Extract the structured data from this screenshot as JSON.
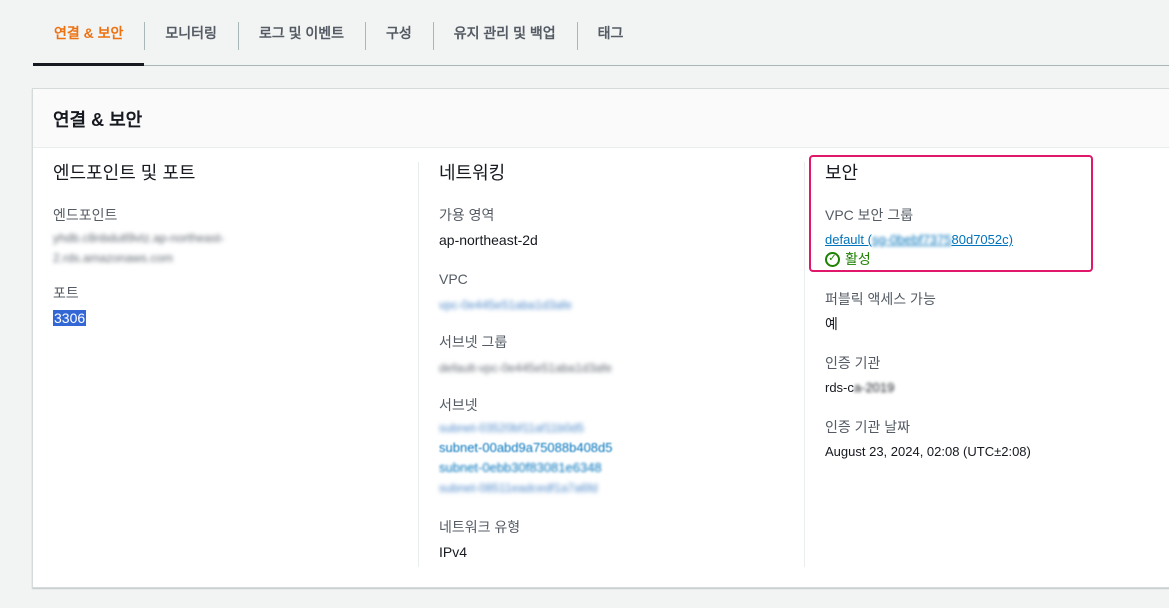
{
  "tabs": [
    {
      "label": "연결 & 보안",
      "active": true
    },
    {
      "label": "모니터링",
      "active": false
    },
    {
      "label": "로그 및 이벤트",
      "active": false
    },
    {
      "label": "구성",
      "active": false
    },
    {
      "label": "유지 관리 및 백업",
      "active": false
    },
    {
      "label": "태그",
      "active": false
    }
  ],
  "panel": {
    "title": "연결 & 보안",
    "endpoint_section": {
      "title": "엔드포인트 및 포트",
      "endpoint_label": "엔드포인트",
      "endpoint_value_line1": "yhdb.c8nbdutl9vtz.ap-northeast-",
      "endpoint_value_line2": "2.rds.amazonaws.com",
      "port_label": "포트",
      "port_value": "3306"
    },
    "network_section": {
      "title": "네트워킹",
      "az_label": "가용 영역",
      "az_value": "ap-northeast-2d",
      "vpc_label": "VPC",
      "vpc_value": "vpc-0e445e51aba1d3afe",
      "subnet_group_label": "서브넷 그룹",
      "subnet_group_value": "default-vpc-0e445e51aba1d3afe",
      "subnets_label": "서브넷",
      "subnets": [
        "subnet-03520bf11af11b0d5",
        "subnet-00abd9a75088b408d5",
        "subnet-0ebb30f83081e6348",
        "subnet-08511eadcedf1a7a6fd"
      ],
      "network_type_label": "네트워크 유형",
      "network_type_value": "IPv4"
    },
    "security_section": {
      "title": "보안",
      "sg_label": "VPC 보안 그룹",
      "sg_value_prefix": "default (",
      "sg_value_blurred": "sg-0bebf7375",
      "sg_value_suffix": "80d7052c)",
      "sg_status": "활성",
      "public_access_label": "퍼블릭 액세스 가능",
      "public_access_value": "예",
      "ca_label": "인증 기관",
      "ca_value_prefix": "rds-c",
      "ca_value_blurred": "a-2019",
      "ca_date_label": "인증 기관 날짜",
      "ca_date_value": "August 23, 2024, 02:08 (UTC±2:08)"
    }
  },
  "colors": {
    "active_tab": "#ec7211",
    "link": "#0073bb",
    "highlight": "#e1176b",
    "status_ok": "#1d8102"
  }
}
